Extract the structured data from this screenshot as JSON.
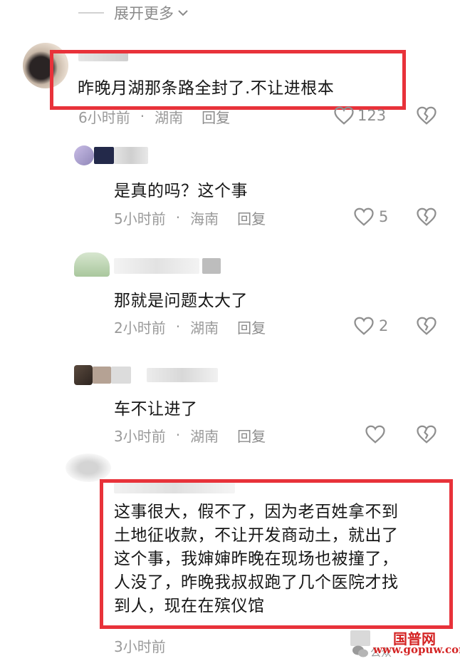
{
  "expand": {
    "label": "展开更多"
  },
  "comments": [
    {
      "text": "昨晚月湖那条路全封了.不让进根本",
      "time": "6小时前",
      "location": "湖南",
      "reply": "回复",
      "likes": "123"
    },
    {
      "text": "是真的吗？这个事",
      "time": "5小时前",
      "location": "海南",
      "reply": "回复",
      "likes": "5"
    },
    {
      "text": "那就是问题太大了",
      "time": "2小时前",
      "location": "湖南",
      "reply": "回复",
      "likes": "2"
    },
    {
      "text": "车不让进了",
      "time": "3小时前",
      "location": "湖南",
      "reply": "回复",
      "likes": ""
    },
    {
      "lines": [
        "这事很大，假不了，因为老百姓拿不到",
        "土地征收款，不让开发商动土，就出了",
        "这个事，我婶婶昨晚在现场也被撞了，",
        "人没了，昨晚我叔叔跑了几个医院才找",
        "到人，现在在殡仪馆"
      ],
      "time": "3小时前"
    }
  ],
  "separator": "·",
  "watermark": {
    "brand": "国普网",
    "url": "www.gopuw.com",
    "account": "公众"
  },
  "colors": {
    "highlight_border": "#e8323a",
    "meta_text": "#9a9a9a",
    "watermark": "#d42424"
  },
  "icons": [
    "chevron-down-icon",
    "heart-icon",
    "broken-heart-icon",
    "wechat-icon"
  ]
}
